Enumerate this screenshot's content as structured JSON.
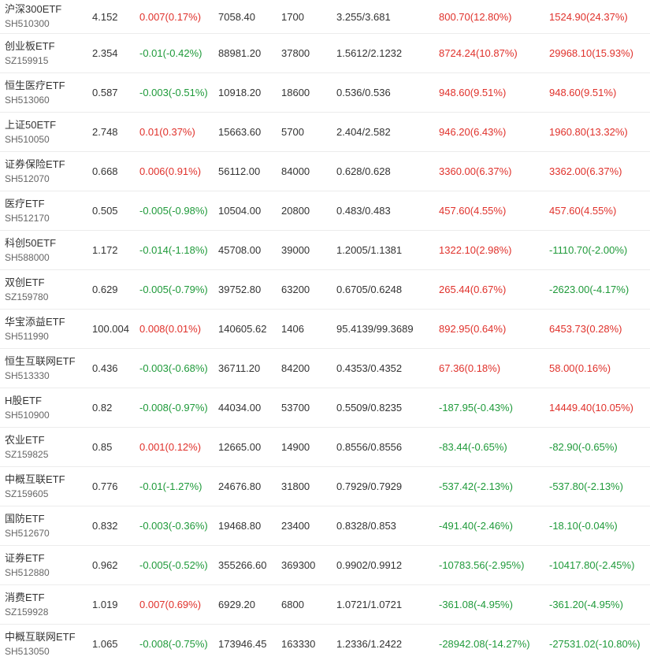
{
  "colors": {
    "up": "#e0312b",
    "down": "#1f9a3a",
    "text": "#333333",
    "code": "#666666",
    "divider": "#ececec"
  },
  "rows": [
    {
      "name": "沪深300ETF",
      "code": "SH510300",
      "price": "4.152",
      "change": "0.007(0.17%)",
      "change_dir": "up",
      "market_value": "7058.40",
      "quantity": "1700",
      "cost": "3.255/3.681",
      "pnl_today": "800.70(12.80%)",
      "pnl_today_dir": "up",
      "pnl_total": "1524.90(24.37%)",
      "pnl_total_dir": "up"
    },
    {
      "name": "创业板ETF",
      "code": "SZ159915",
      "price": "2.354",
      "change": "-0.01(-0.42%)",
      "change_dir": "down",
      "market_value": "88981.20",
      "quantity": "37800",
      "cost": "1.5612/2.1232",
      "pnl_today": "8724.24(10.87%)",
      "pnl_today_dir": "up",
      "pnl_total": "29968.10(15.93%)",
      "pnl_total_dir": "up"
    },
    {
      "name": "恒生医疗ETF",
      "code": "SH513060",
      "price": "0.587",
      "change": "-0.003(-0.51%)",
      "change_dir": "down",
      "market_value": "10918.20",
      "quantity": "18600",
      "cost": "0.536/0.536",
      "pnl_today": "948.60(9.51%)",
      "pnl_today_dir": "up",
      "pnl_total": "948.60(9.51%)",
      "pnl_total_dir": "up"
    },
    {
      "name": "上证50ETF",
      "code": "SH510050",
      "price": "2.748",
      "change": "0.01(0.37%)",
      "change_dir": "up",
      "market_value": "15663.60",
      "quantity": "5700",
      "cost": "2.404/2.582",
      "pnl_today": "946.20(6.43%)",
      "pnl_today_dir": "up",
      "pnl_total": "1960.80(13.32%)",
      "pnl_total_dir": "up"
    },
    {
      "name": "证券保险ETF",
      "code": "SH512070",
      "price": "0.668",
      "change": "0.006(0.91%)",
      "change_dir": "up",
      "market_value": "56112.00",
      "quantity": "84000",
      "cost": "0.628/0.628",
      "pnl_today": "3360.00(6.37%)",
      "pnl_today_dir": "up",
      "pnl_total": "3362.00(6.37%)",
      "pnl_total_dir": "up"
    },
    {
      "name": "医疗ETF",
      "code": "SH512170",
      "price": "0.505",
      "change": "-0.005(-0.98%)",
      "change_dir": "down",
      "market_value": "10504.00",
      "quantity": "20800",
      "cost": "0.483/0.483",
      "pnl_today": "457.60(4.55%)",
      "pnl_today_dir": "up",
      "pnl_total": "457.60(4.55%)",
      "pnl_total_dir": "up"
    },
    {
      "name": "科创50ETF",
      "code": "SH588000",
      "price": "1.172",
      "change": "-0.014(-1.18%)",
      "change_dir": "down",
      "market_value": "45708.00",
      "quantity": "39000",
      "cost": "1.2005/1.1381",
      "pnl_today": "1322.10(2.98%)",
      "pnl_today_dir": "up",
      "pnl_total": "-1110.70(-2.00%)",
      "pnl_total_dir": "down"
    },
    {
      "name": "双创ETF",
      "code": "SZ159780",
      "price": "0.629",
      "change": "-0.005(-0.79%)",
      "change_dir": "down",
      "market_value": "39752.80",
      "quantity": "63200",
      "cost": "0.6705/0.6248",
      "pnl_today": "265.44(0.67%)",
      "pnl_today_dir": "up",
      "pnl_total": "-2623.00(-4.17%)",
      "pnl_total_dir": "down"
    },
    {
      "name": "华宝添益ETF",
      "code": "SH511990",
      "price": "100.004",
      "change": "0.008(0.01%)",
      "change_dir": "up",
      "market_value": "140605.62",
      "quantity": "1406",
      "cost": "95.4139/99.3689",
      "pnl_today": "892.95(0.64%)",
      "pnl_today_dir": "up",
      "pnl_total": "6453.73(0.28%)",
      "pnl_total_dir": "up"
    },
    {
      "name": "恒生互联网ETF",
      "code": "SH513330",
      "price": "0.436",
      "change": "-0.003(-0.68%)",
      "change_dir": "down",
      "market_value": "36711.20",
      "quantity": "84200",
      "cost": "0.4353/0.4352",
      "pnl_today": "67.36(0.18%)",
      "pnl_today_dir": "up",
      "pnl_total": "58.00(0.16%)",
      "pnl_total_dir": "up"
    },
    {
      "name": "H股ETF",
      "code": "SH510900",
      "price": "0.82",
      "change": "-0.008(-0.97%)",
      "change_dir": "down",
      "market_value": "44034.00",
      "quantity": "53700",
      "cost": "0.5509/0.8235",
      "pnl_today": "-187.95(-0.43%)",
      "pnl_today_dir": "down",
      "pnl_total": "14449.40(10.05%)",
      "pnl_total_dir": "up"
    },
    {
      "name": "农业ETF",
      "code": "SZ159825",
      "price": "0.85",
      "change": "0.001(0.12%)",
      "change_dir": "up",
      "market_value": "12665.00",
      "quantity": "14900",
      "cost": "0.8556/0.8556",
      "pnl_today": "-83.44(-0.65%)",
      "pnl_today_dir": "down",
      "pnl_total": "-82.90(-0.65%)",
      "pnl_total_dir": "down"
    },
    {
      "name": "中概互联ETF",
      "code": "SZ159605",
      "price": "0.776",
      "change": "-0.01(-1.27%)",
      "change_dir": "down",
      "market_value": "24676.80",
      "quantity": "31800",
      "cost": "0.7929/0.7929",
      "pnl_today": "-537.42(-2.13%)",
      "pnl_today_dir": "down",
      "pnl_total": "-537.80(-2.13%)",
      "pnl_total_dir": "down"
    },
    {
      "name": "国防ETF",
      "code": "SH512670",
      "price": "0.832",
      "change": "-0.003(-0.36%)",
      "change_dir": "down",
      "market_value": "19468.80",
      "quantity": "23400",
      "cost": "0.8328/0.853",
      "pnl_today": "-491.40(-2.46%)",
      "pnl_today_dir": "down",
      "pnl_total": "-18.10(-0.04%)",
      "pnl_total_dir": "down"
    },
    {
      "name": "证券ETF",
      "code": "SH512880",
      "price": "0.962",
      "change": "-0.005(-0.52%)",
      "change_dir": "down",
      "market_value": "355266.60",
      "quantity": "369300",
      "cost": "0.9902/0.9912",
      "pnl_today": "-10783.56(-2.95%)",
      "pnl_today_dir": "down",
      "pnl_total": "-10417.80(-2.45%)",
      "pnl_total_dir": "down"
    },
    {
      "name": "消费ETF",
      "code": "SZ159928",
      "price": "1.019",
      "change": "0.007(0.69%)",
      "change_dir": "up",
      "market_value": "6929.20",
      "quantity": "6800",
      "cost": "1.0721/1.0721",
      "pnl_today": "-361.08(-4.95%)",
      "pnl_today_dir": "down",
      "pnl_total": "-361.20(-4.95%)",
      "pnl_total_dir": "down"
    },
    {
      "name": "中概互联网ETF",
      "code": "SH513050",
      "price": "1.065",
      "change": "-0.008(-0.75%)",
      "change_dir": "down",
      "market_value": "173946.45",
      "quantity": "163330",
      "cost": "1.2336/1.2422",
      "pnl_today": "-28942.08(-14.27%)",
      "pnl_today_dir": "down",
      "pnl_total": "-27531.02(-10.80%)",
      "pnl_total_dir": "down"
    }
  ]
}
